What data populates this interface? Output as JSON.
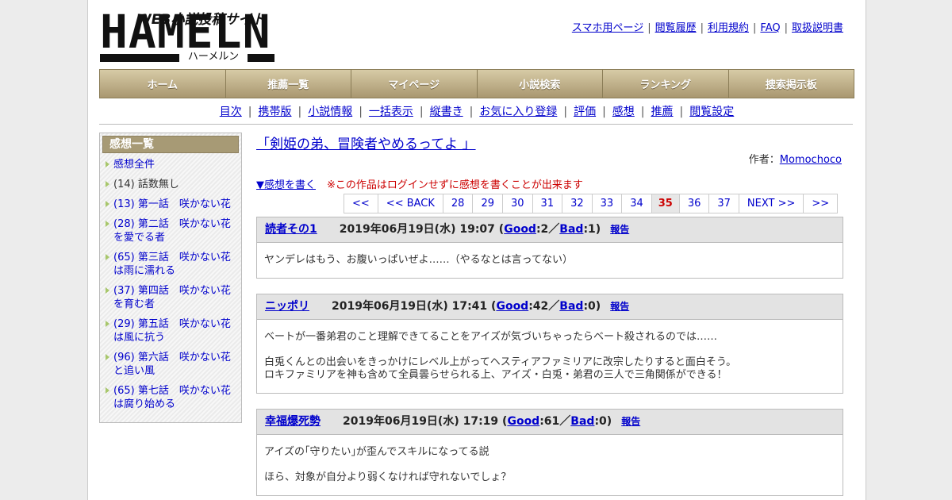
{
  "logo": {
    "main": "HAMELN",
    "tagline": "WEB小説投稿サイト",
    "kana": "ハーメルン"
  },
  "toplinks": [
    "スマホ用ページ",
    "閲覧履歴",
    "利用規約",
    "FAQ",
    "取扱説明書"
  ],
  "gnav": [
    "ホーム",
    "推薦一覧",
    "マイページ",
    "小説検索",
    "ランキング",
    "捜索掲示板"
  ],
  "subnav": [
    "目次",
    "携帯版",
    "小説情報",
    "一括表示",
    "縦書き",
    "お気に入り登録",
    "評価",
    "感想",
    "推薦",
    "閲覧設定"
  ],
  "sidebar": {
    "title": "感想一覧",
    "items": [
      {
        "text": "感想全件",
        "link": true
      },
      {
        "text": "(14) 話数無し",
        "link": false
      },
      {
        "text": "(13) 第一話　咲かない花",
        "link": true
      },
      {
        "text": "(28) 第二話　咲かない花を愛でる者",
        "link": true
      },
      {
        "text": "(65) 第三話　咲かない花は雨に濡れる",
        "link": true
      },
      {
        "text": "(37) 第四話　咲かない花を育む者",
        "link": true
      },
      {
        "text": "(29) 第五話　咲かない花は風に抗う",
        "link": true
      },
      {
        "text": "(96) 第六話　咲かない花と追い風",
        "link": true
      },
      {
        "text": "(65) 第七話　咲かない花は腐り始める",
        "link": true
      }
    ]
  },
  "main": {
    "title": "「剣姫の弟、冒険者やめるってよ 」",
    "author_label": "作者：",
    "author": "Momochoco",
    "write_link": "▼感想を書く",
    "write_note": "※この作品はログインせずに感想を書くことが出来ます",
    "pager": [
      "<<",
      "<< BACK",
      "28",
      "29",
      "30",
      "31",
      "32",
      "33",
      "34",
      "35",
      "36",
      "37",
      "NEXT >>",
      ">>"
    ],
    "current_page": "35"
  },
  "posts": [
    {
      "name": "読者その1",
      "date": "2019年06月19日(水) 19:07",
      "good": "2",
      "bad": "1",
      "lines": [
        "ヤンデレはもう、お腹いっぱいぜよ……（やるなとは言ってない）"
      ]
    },
    {
      "name": "ニッポリ",
      "date": "2019年06月19日(水) 17:41",
      "good": "42",
      "bad": "0",
      "lines": [
        "ベートが一番弟君のこと理解できてることをアイズが気づいちゃったらベート殺されるのでは……",
        "白兎くんとの出会いをきっかけにレベル上がってヘスティアファミリアに改宗したりすると面白そう。",
        "ロキファミリアを神も含めて全員曇らせられる上、アイズ・白兎・弟君の三人で三角関係ができる！"
      ]
    },
    {
      "name": "幸福爆死勢",
      "date": "2019年06月19日(水) 17:19",
      "good": "61",
      "bad": "0",
      "lines": [
        "アイズの｢守りたい｣が歪んでスキルになってる説",
        "ほら、対象が自分より弱くなければ守れないでしょ？"
      ]
    }
  ],
  "labels": {
    "good": "Good",
    "bad": "Bad",
    "report": "報告"
  }
}
